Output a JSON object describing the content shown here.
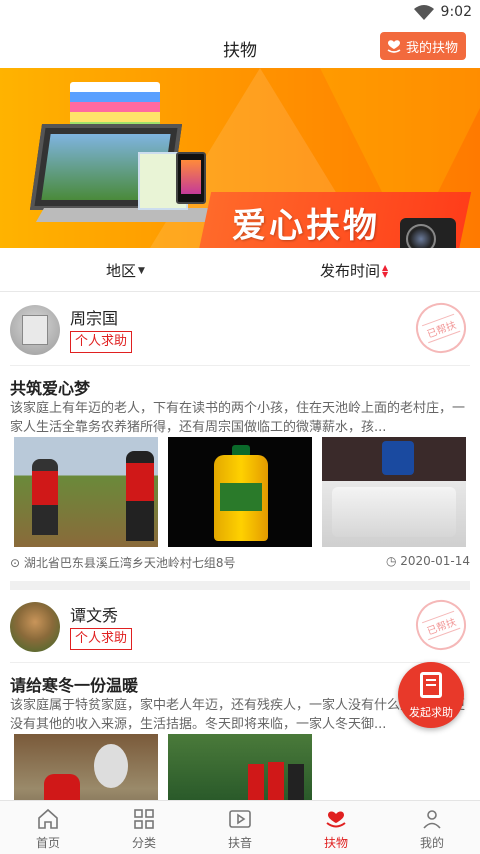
{
  "status": {
    "time": "9:02"
  },
  "header": {
    "title": "扶物",
    "my_button": "我的扶物"
  },
  "banner": {
    "slogan": "爱心扶物"
  },
  "filters": [
    {
      "label": "地区",
      "indicator": "caret-down"
    },
    {
      "label": "发布时间",
      "indicator": "sort-arrows"
    }
  ],
  "posts": [
    {
      "user": "周宗国",
      "tag": "个人求助",
      "stamp": "已帮扶",
      "title": "共筑爱心梦",
      "desc": "该家庭上有年迈的老人，下有在读书的两个小孩，住在天池岭上面的老村庄，一家人生活全靠务农养猪所得，还有周宗国做临工的微薄薪水，孩...",
      "location": "湖北省巴东县溪丘湾乡天池岭村七组8号",
      "date": "2020-01-14"
    },
    {
      "user": "谭文秀",
      "tag": "个人求助",
      "stamp": "已帮扶",
      "title": "请给寒冬一份温暖",
      "desc": "该家庭属于特贫家庭，家中老人年迈，还有残疾人，一家人没有什么劳动力，更没有其他的收入来源，生活拮据。冬天即将来临，一家人冬天御..."
    }
  ],
  "fab": {
    "label": "发起求助"
  },
  "tabs": [
    {
      "label": "首页",
      "icon": "home-icon"
    },
    {
      "label": "分类",
      "icon": "grid-icon"
    },
    {
      "label": "扶音",
      "icon": "play-icon"
    },
    {
      "label": "扶物",
      "icon": "heart-hands-icon",
      "active": true
    },
    {
      "label": "我的",
      "icon": "user-icon"
    }
  ],
  "colors": {
    "accent": "#e02020",
    "banner": "#ff9a00",
    "button": "#f26a3d"
  }
}
